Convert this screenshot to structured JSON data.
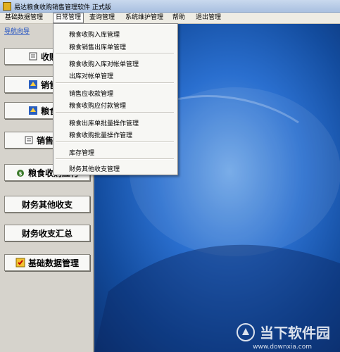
{
  "window": {
    "title": "易达粮食收购销售管理软件 正式版"
  },
  "menubar": [
    "基础数据管理",
    "日常管理",
    "查询管理",
    "系统维护管理",
    "帮助",
    "退出管理"
  ],
  "sidebar": {
    "nav_link": "导航向导",
    "buttons": [
      "收购入",
      "销售出",
      "粮食库",
      "销售应收",
      "粮食收购应付",
      "财务其他收支",
      "财务收支汇总",
      "基础数据管理"
    ]
  },
  "dropdown": {
    "items": [
      "粮食收购入库管理",
      "粮食销售出库单管理",
      "粮食收购入库对帐单管理",
      "出库对帐单管理",
      "销售应收款管理",
      "粮食收购应付款管理",
      "粮食出库单批量操作管理",
      "粮食收购批量操作管理",
      "库存管理",
      "财务其他收支管理"
    ]
  },
  "watermark": {
    "text": "当下软件园",
    "url": "www.downxia.com"
  }
}
